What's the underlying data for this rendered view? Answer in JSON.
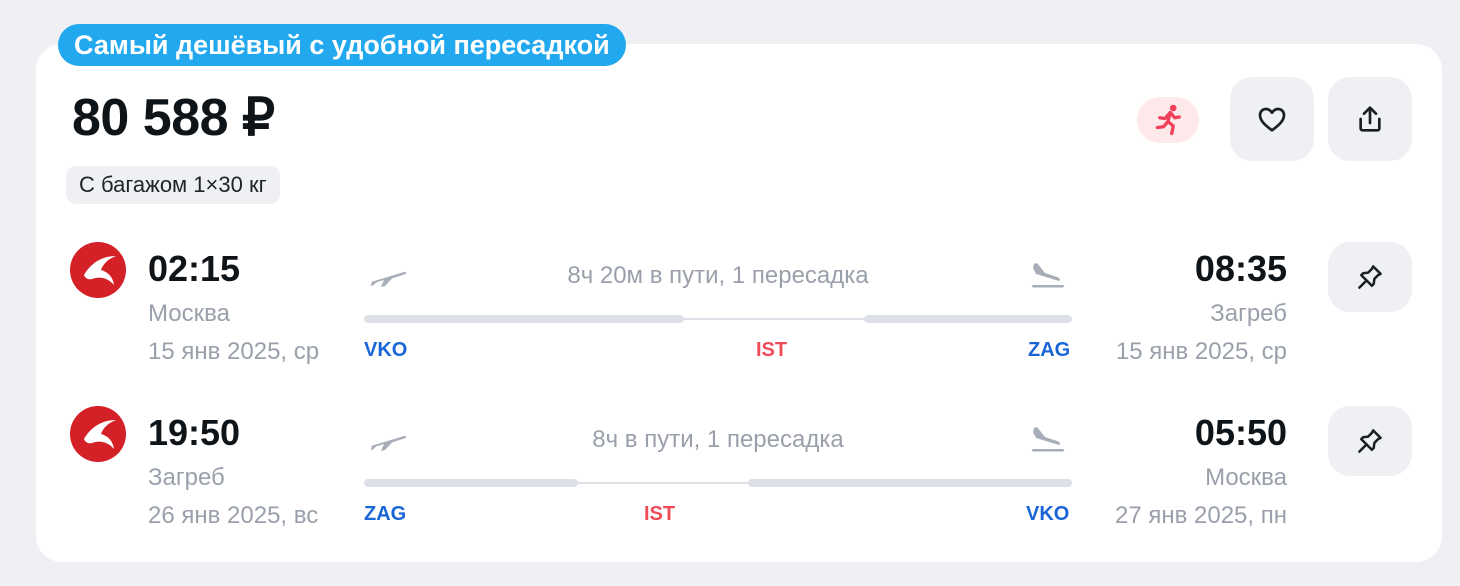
{
  "badge": "Самый дешёвый с удобной пересадкой",
  "price": "80 588 ₽",
  "baggage": "С багажом 1×30 кг",
  "icons": {
    "runner": "running-person-icon",
    "favorite": "heart-icon",
    "share": "share-icon",
    "pin": "pin-icon",
    "airline": "turkish-airlines-logo",
    "takeoff": "takeoff-plane-icon",
    "landing": "landing-plane-icon"
  },
  "colors": {
    "badge": "#22a8ef",
    "airline_red": "#d42027",
    "airport_blue": "#1a66d8",
    "transfer_red": "#ef4c5a",
    "runner_bg": "#fde8ea"
  },
  "segments": [
    {
      "dep_time": "02:15",
      "dep_city": "Москва",
      "dep_date": "15 янв 2025, ср",
      "duration": "8ч 20м в пути, 1 пересадка",
      "from_code": "VKO",
      "transfer_code": "IST",
      "to_code": "ZAG",
      "arr_time": "08:35",
      "arr_city": "Загреб",
      "arr_date": "15 янв 2025, ср"
    },
    {
      "dep_time": "19:50",
      "dep_city": "Загреб",
      "dep_date": "26 янв 2025, вс",
      "duration": "8ч в пути, 1 пересадка",
      "from_code": "ZAG",
      "transfer_code": "IST",
      "to_code": "VKO",
      "arr_time": "05:50",
      "arr_city": "Москва",
      "arr_date": "27 янв 2025, пн"
    }
  ]
}
